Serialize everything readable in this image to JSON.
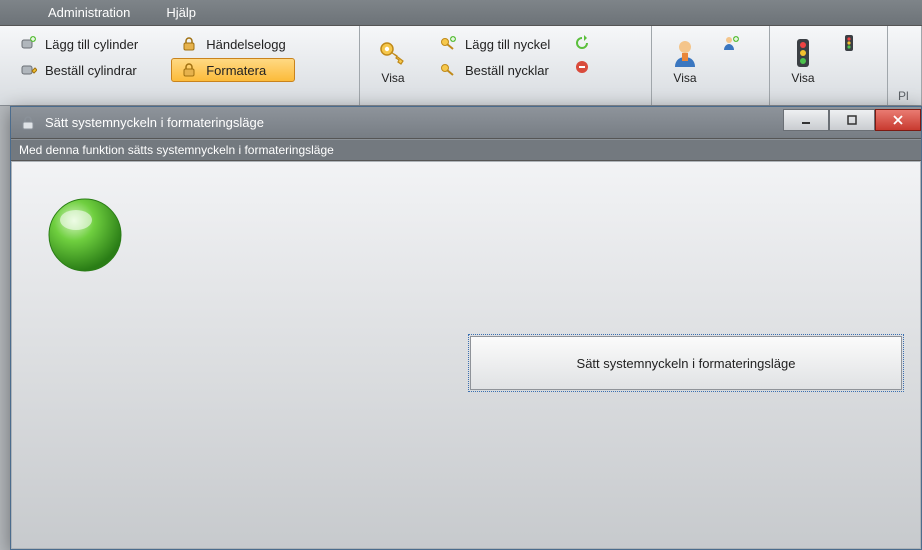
{
  "menu": {
    "items": [
      "Administration",
      "Hjälp"
    ]
  },
  "ribbon": {
    "group1": {
      "btn1": "Lägg till cylinder",
      "btn2": "Beställ cylindrar",
      "btn3": "Händelselogg",
      "btn4": "Formatera"
    },
    "group2": {
      "visa": "Visa",
      "btn1": "Lägg till nyckel",
      "btn2": "Beställ nycklar"
    },
    "group3": {
      "visa": "Visa"
    },
    "group4": {
      "visa": "Visa"
    },
    "group5": {
      "label": "Pl"
    }
  },
  "dialog": {
    "title": "Sätt systemnyckeln i formateringsläge",
    "subtitle": "Med denna funktion sätts systemnyckeln i formateringsläge",
    "button": "Sätt systemnyckeln i formateringsläge"
  }
}
